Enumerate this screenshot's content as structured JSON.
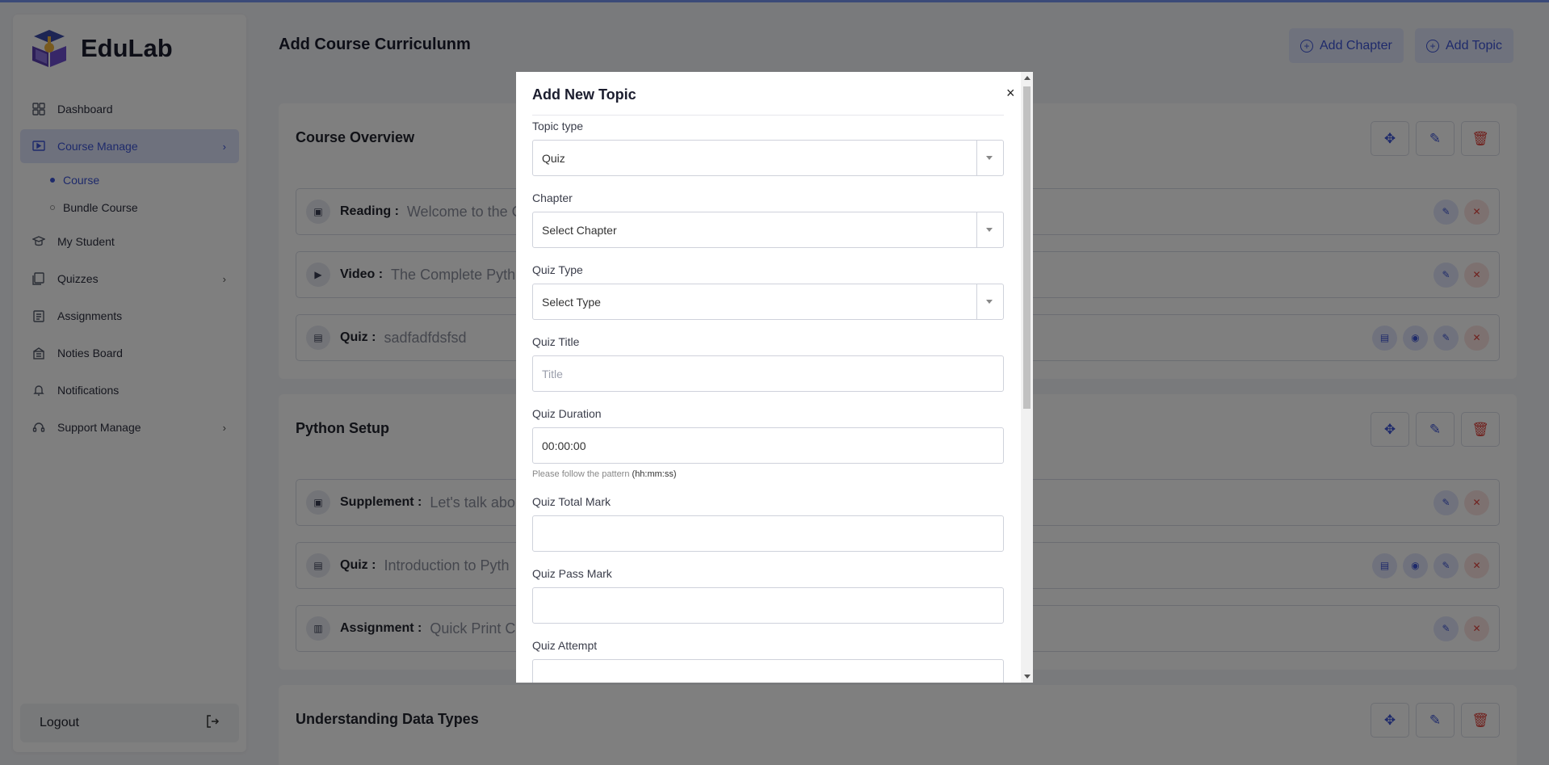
{
  "brand": {
    "name": "EduLab"
  },
  "sidebar": {
    "items": [
      {
        "label": "Dashboard",
        "icon": "dashboard-icon"
      },
      {
        "label": "Course Manage",
        "icon": "course-icon",
        "active": true
      },
      {
        "label": "My Student",
        "icon": "student-icon"
      },
      {
        "label": "Quizzes",
        "icon": "quiz-icon"
      },
      {
        "label": "Assignments",
        "icon": "assignment-icon"
      },
      {
        "label": "Noties Board",
        "icon": "notice-board-icon"
      },
      {
        "label": "Notifications",
        "icon": "bell-icon"
      },
      {
        "label": "Support Manage",
        "icon": "headset-icon"
      }
    ],
    "sub_items": [
      {
        "label": "Course",
        "active": true
      },
      {
        "label": "Bundle Course"
      }
    ],
    "logout_label": "Logout"
  },
  "header": {
    "title": "Add Course Curriculunm",
    "add_chapter_label": "Add Chapter",
    "add_topic_label": "Add Topic"
  },
  "sections": [
    {
      "title": "Course Overview",
      "rows": [
        {
          "label": "Reading :",
          "text": "Welcome to the C"
        },
        {
          "label": "Video :",
          "text": "The Complete Pyth"
        },
        {
          "label": "Quiz :",
          "text": "sadfadfdsfsd"
        }
      ]
    },
    {
      "title": "Python Setup",
      "rows": [
        {
          "label": "Supplement :",
          "text": "Let's talk abo"
        },
        {
          "label": "Quiz :",
          "text": "Introduction to Pyth"
        },
        {
          "label": "Assignment :",
          "text": "Quick Print C"
        }
      ]
    },
    {
      "title": "Understanding Data Types",
      "rows": []
    }
  ],
  "modal": {
    "title": "Add New Topic",
    "close_symbol": "×",
    "fields": {
      "topic_type": {
        "label": "Topic type",
        "value": "Quiz"
      },
      "chapter": {
        "label": "Chapter",
        "value": "Select Chapter"
      },
      "quiz_type": {
        "label": "Quiz Type",
        "value": "Select Type"
      },
      "quiz_title": {
        "label": "Quiz Title",
        "placeholder": "Title"
      },
      "quiz_duration": {
        "label": "Quiz Duration",
        "value": "00:00:00",
        "help": "Please follow the pattern",
        "help_pattern": "(hh:mm:ss)"
      },
      "quiz_total_mark": {
        "label": "Quiz Total Mark",
        "value": ""
      },
      "quiz_pass_mark": {
        "label": "Quiz Pass Mark",
        "value": ""
      },
      "quiz_attempt": {
        "label": "Quiz Attempt",
        "value": ""
      }
    }
  },
  "colors": {
    "primary": "#3d55d6",
    "danger": "#e0433c",
    "overlay": "rgba(0,0,0,0.5)"
  }
}
